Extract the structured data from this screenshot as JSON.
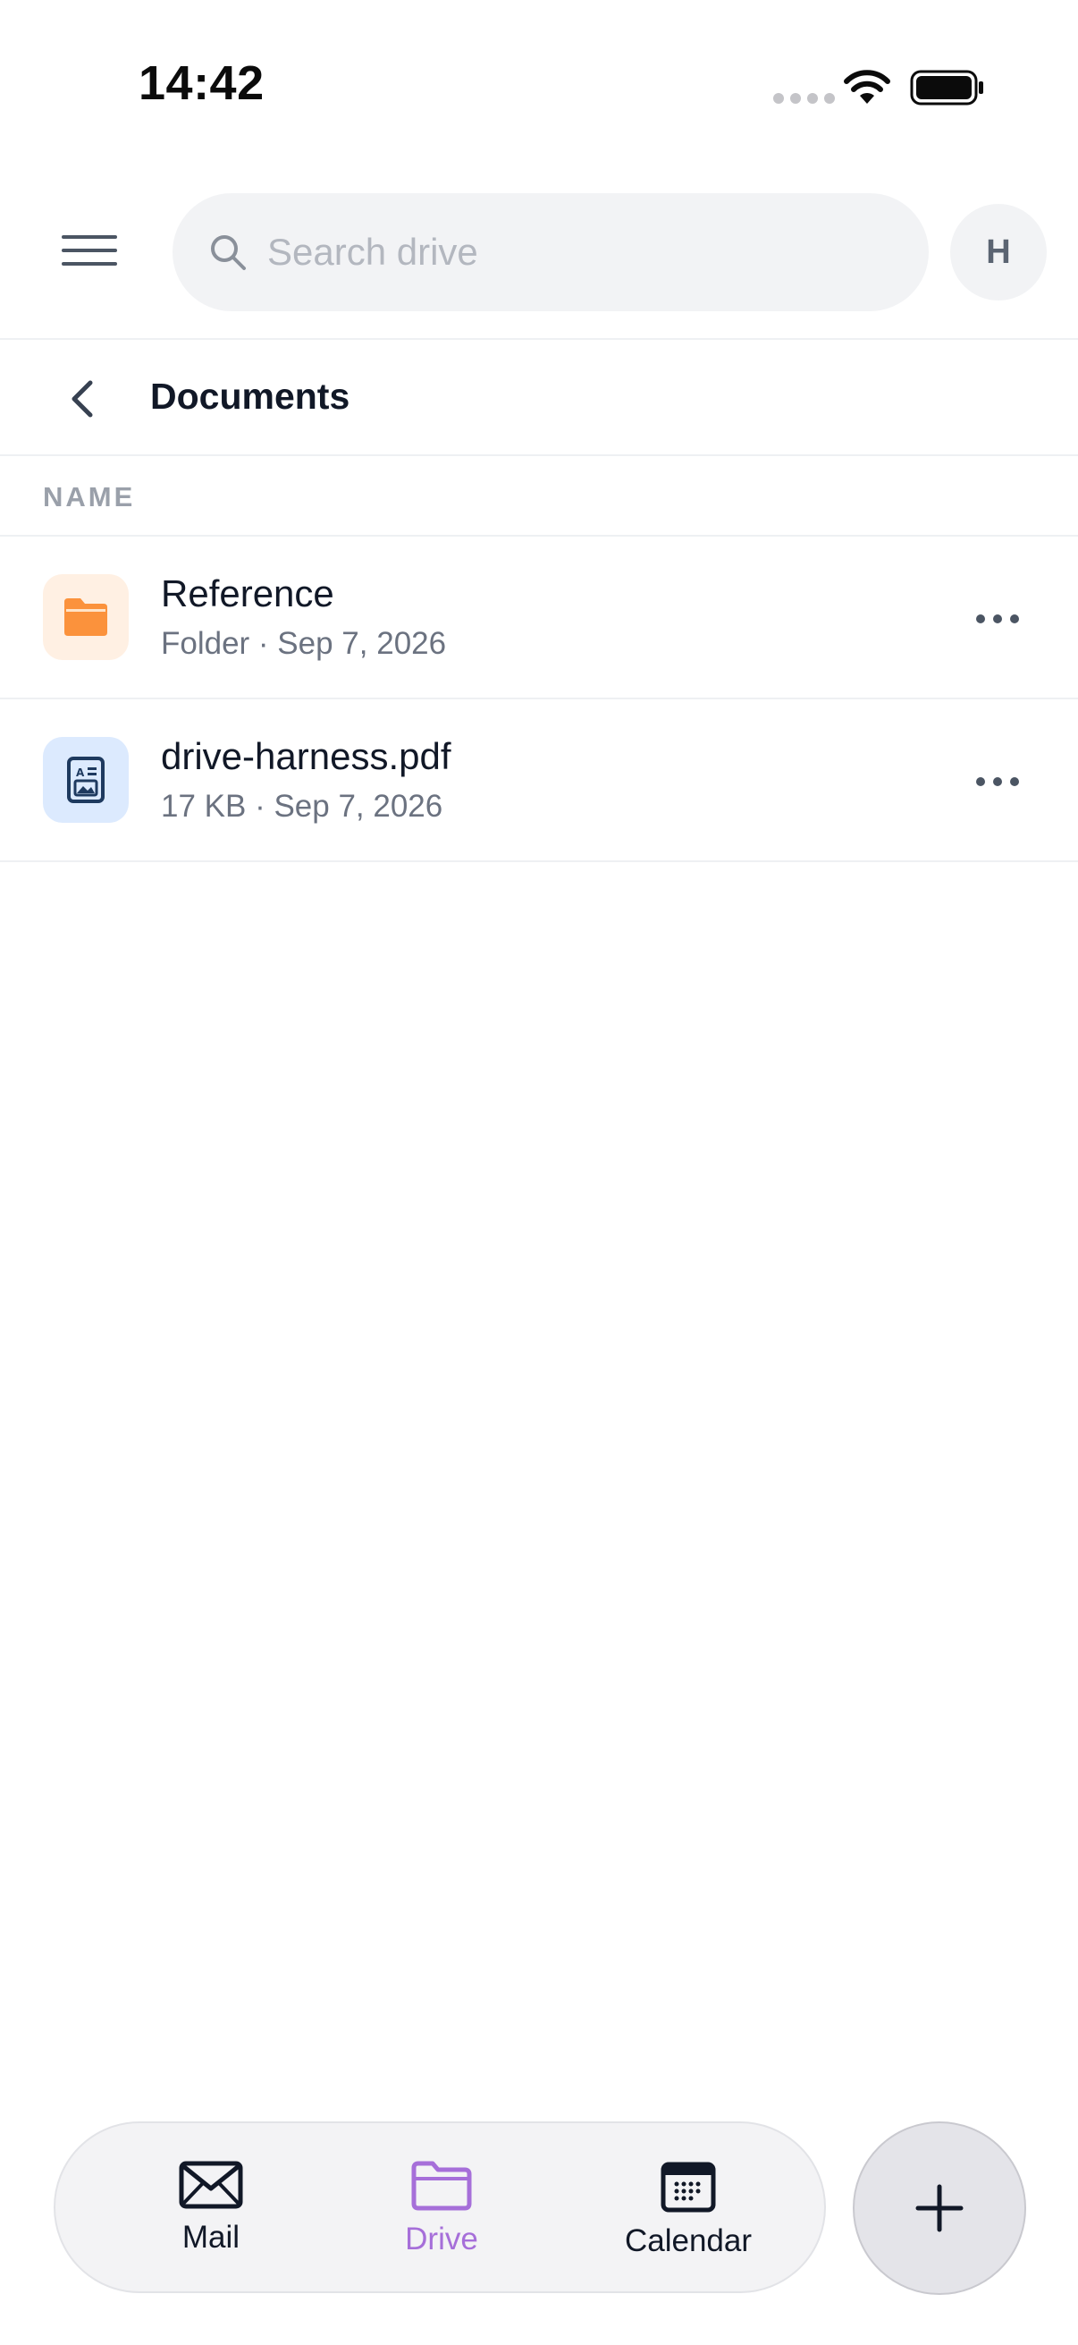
{
  "status_bar": {
    "time": "14:42"
  },
  "top_bar": {
    "search_placeholder": "Search drive",
    "avatar_initial": "H"
  },
  "folder": {
    "title": "Documents"
  },
  "list": {
    "column_header": "NAME",
    "items": [
      {
        "name": "Reference",
        "meta": "Folder · Sep 7, 2026",
        "icon": "folder-icon"
      },
      {
        "name": "drive-harness.pdf",
        "meta": "17 KB · Sep 7, 2026",
        "icon": "document-icon"
      }
    ]
  },
  "tabs": [
    {
      "label": "Mail",
      "icon": "mail-icon",
      "active": false
    },
    {
      "label": "Drive",
      "icon": "folder-icon",
      "active": true
    },
    {
      "label": "Calendar",
      "icon": "calendar-icon",
      "active": false
    }
  ],
  "colors": {
    "accent": "#a66fd9",
    "folder_orange": "#fb923c",
    "document_blue": "#1e3a5f"
  }
}
